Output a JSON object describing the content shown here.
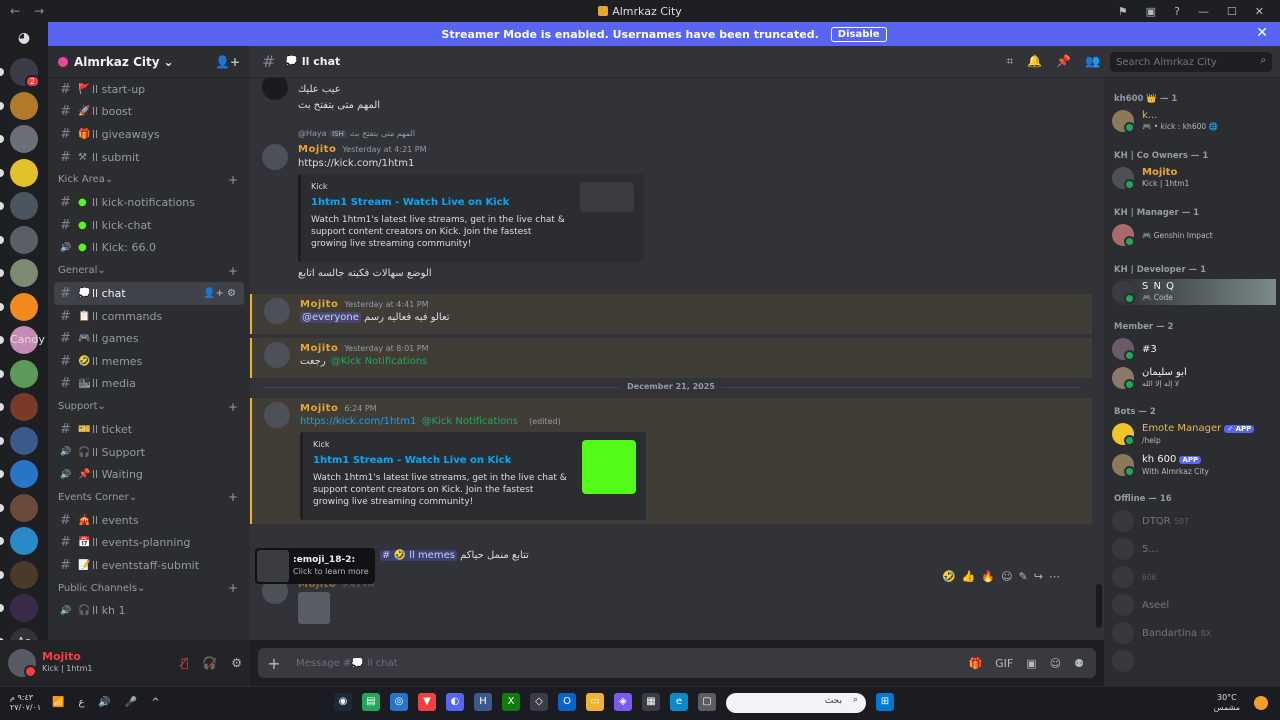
{
  "window": {
    "title": "Almrkaz City",
    "back": "←",
    "forward": "→",
    "controls": [
      "⚑",
      "▣",
      "?",
      "—",
      "☐",
      "✕"
    ]
  },
  "banner": {
    "text": "Streamer Mode is enabled. Usernames have been truncated.",
    "button": "Disable"
  },
  "server": {
    "name": "Almrkaz City",
    "chevron": "⌄"
  },
  "rail": {
    "home_icon": "discord-icon",
    "servers": [
      {
        "label": "",
        "color": "#3a3d45",
        "badge": "2"
      },
      {
        "label": "",
        "color": "#b07a2c"
      },
      {
        "label": "",
        "color": "#6a6f78"
      },
      {
        "label": "",
        "color": "#e2c12a"
      },
      {
        "label": "",
        "color": "#4a5560"
      },
      {
        "label": "",
        "color": "#5a5e66"
      },
      {
        "label": "",
        "color": "#7b8a70"
      },
      {
        "label": "",
        "color": "#f08a1c"
      },
      {
        "label": "Candy",
        "color": "#c58ab5"
      },
      {
        "label": "",
        "color": "#5c9a5a"
      },
      {
        "label": "",
        "color": "#7a3a2a"
      },
      {
        "label": "",
        "color": "#3a5a8a"
      },
      {
        "label": "",
        "color": "#2a74c8"
      },
      {
        "label": "",
        "color": "#6a4a3a"
      },
      {
        "label": "",
        "color": "#2a8ac8"
      },
      {
        "label": "",
        "color": "#4a3a2a"
      },
      {
        "label": "",
        "color": "#3a2a4a"
      },
      {
        "label": "Ac",
        "color": "#313338"
      }
    ]
  },
  "channels": {
    "top": [
      {
        "emoji": "🚩",
        "name": "ll start-up"
      },
      {
        "emoji": "🚀",
        "name": "ll boost"
      },
      {
        "emoji": "🎁",
        "name": "ll giveaways"
      },
      {
        "emoji": "⚒",
        "name": "ll submit"
      }
    ],
    "kick_area": {
      "label": "Kick Area",
      "items": [
        {
          "emoji": "●",
          "name": "ll kick-notifications",
          "type": "text"
        },
        {
          "emoji": "●",
          "name": "ll kick-chat",
          "type": "text"
        },
        {
          "emoji": "●",
          "name": "ll Kick: 66.0",
          "type": "voice"
        }
      ]
    },
    "general": {
      "label": "General",
      "items": [
        {
          "emoji": "💭",
          "name": "ll chat",
          "active": true
        },
        {
          "emoji": "📋",
          "name": "ll commands"
        },
        {
          "emoji": "🎮",
          "name": "ll games"
        },
        {
          "emoji": "🤣",
          "name": "ll memes"
        },
        {
          "emoji": "🏙",
          "name": "ll media"
        }
      ]
    },
    "support": {
      "label": "Support",
      "items": [
        {
          "emoji": "🎫",
          "name": "ll ticket",
          "type": "text"
        },
        {
          "emoji": "🎧",
          "name": "ll Support",
          "type": "voice"
        },
        {
          "emoji": "📌",
          "name": "ll Waiting",
          "type": "voice"
        }
      ]
    },
    "events": {
      "label": "Events Corner",
      "items": [
        {
          "emoji": "🎪",
          "name": "ll events"
        },
        {
          "emoji": "📅",
          "name": "ll events-planning"
        },
        {
          "emoji": "📝",
          "name": "ll eventstaff-submit"
        }
      ]
    },
    "public": {
      "label": "Public Channels",
      "items": [
        {
          "emoji": "🎧",
          "name": "ll kh 1",
          "type": "voice"
        }
      ]
    }
  },
  "user": {
    "name": "Mojito",
    "status": "Kick | 1htm1"
  },
  "header": {
    "channel": "ll chat",
    "channel_emoji": "💭",
    "search_placeholder": "Search Almrkaz City"
  },
  "messages": {
    "m0": {
      "line1": "عيب عليك",
      "line2": "المهم متى بتفتح بث"
    },
    "m1": {
      "reply_user": "@Haya",
      "reply_tag": "ISH",
      "reply_text": "المهم متى بتفتح بث",
      "author": "Mojito",
      "time": "Yesterday at 4:21 PM",
      "link": "https://kick.com/1htm1",
      "embed": {
        "provider": "Kick",
        "title": "1htm1 Stream - Watch Live on Kick",
        "desc": "Watch 1htm1's latest live streams, get in the live chat & support content creators on Kick. Join the fastest growing live streaming community!"
      },
      "after": "الوضع سهالات فكيته جالسه اتابع"
    },
    "m2": {
      "author": "Mojito",
      "time": "Yesterday at 4:41 PM",
      "mention": "@everyone",
      "text": "تعالو فيه فعاليه رسم"
    },
    "m3": {
      "author": "Mojito",
      "time": "Yesterday at 8:01 PM",
      "mention": "@Kick Notifications",
      "text": "رجعت"
    },
    "divider": "December 21, 2025",
    "m4": {
      "author": "Mojito",
      "time": "6:24 PM",
      "link": "https://kick.com/1htm1",
      "mention": "@Kick Notifications",
      "edited": "(edited)",
      "embed": {
        "provider": "Kick",
        "title": "1htm1 Stream - Watch Live on Kick",
        "desc": "Watch 1htm1's latest live streams, get in the live chat & support content creators on Kick. Join the fastest growing live streaming community!"
      }
    },
    "m5": {
      "channel_mention": "ll memes",
      "channel_emoji": "🤣",
      "text": "تتابع منمل حياكم"
    },
    "popup": {
      "title": ":emoji_18-2:",
      "sub": "Click to learn more"
    },
    "m6": {
      "author": "Mojito",
      "time": "9:43 PM"
    }
  },
  "reactions": [
    "🤣",
    "👍",
    "🔥",
    "☺",
    "✎",
    "↪",
    "⋯"
  ],
  "composer": {
    "placeholder": "Message #💭 ll chat"
  },
  "members": {
    "g_kh600": {
      "label": "kh600 👑 — 1"
    },
    "m_k": {
      "name": "k...",
      "sub": "🎮 • kick : kh600 🌐"
    },
    "g_co": {
      "label": "KH | Co Owners — 1"
    },
    "m_mojito": {
      "name": "Mojito",
      "sub": "Kick | 1htm1"
    },
    "g_mgr": {
      "label": "KH | Manager — 1"
    },
    "m_mgr": {
      "name": "",
      "sub": "🎮 Genshin Impact"
    },
    "g_dev": {
      "label": "KH | Developer — 1"
    },
    "m_snq": {
      "name": "S N Q",
      "sub": "🎮 Code"
    },
    "g_mem": {
      "label": "Member — 2"
    },
    "m_3": {
      "name": "#3",
      "sub": ""
    },
    "m_arab": {
      "name": "أبو سليمان",
      "sub": "لا إله إلا الله"
    },
    "g_bots": {
      "label": "Bots — 2"
    },
    "m_emote": {
      "name": "Emote Manager",
      "app": "✓ APP",
      "sub": "/help"
    },
    "m_kh600": {
      "name": "kh 600",
      "app": "APP",
      "sub": "With Almrkaz City"
    },
    "g_off": {
      "label": "Offline — 16"
    },
    "offline": [
      {
        "name": "DTQR",
        "sub": "507"
      },
      {
        "name": "5...",
        "sub": ""
      },
      {
        "name": "",
        "sub": "606"
      },
      {
        "name": "Aseel",
        "sub": ""
      },
      {
        "name": "Bandartina",
        "sub": "BX"
      },
      {
        "name": "",
        "sub": ""
      }
    ]
  },
  "taskbar": {
    "date": "٢٧/٠٧/٠١",
    "time": "٩:٤٣ م",
    "search": "بحث",
    "weather_temp": "30°C",
    "weather_desc": "مشمس"
  }
}
